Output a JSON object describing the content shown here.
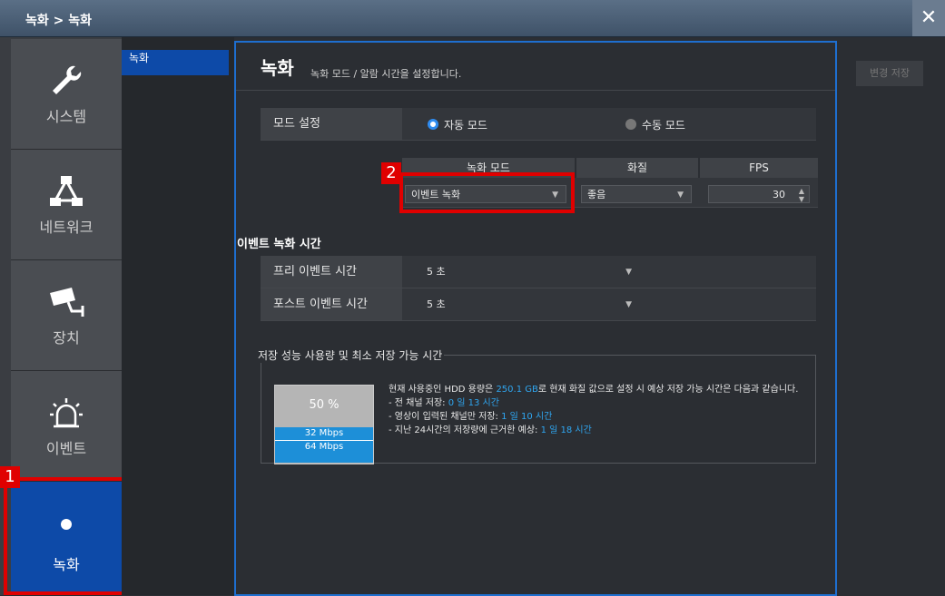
{
  "window": {
    "title": "녹화 > 녹화",
    "close": "✕"
  },
  "sidebar": {
    "items": [
      {
        "label": "시스템",
        "icon": "wrench-icon"
      },
      {
        "label": "네트워크",
        "icon": "network-icon"
      },
      {
        "label": "장치",
        "icon": "camera-icon"
      },
      {
        "label": "이벤트",
        "icon": "alarm-icon"
      },
      {
        "label": "녹화",
        "icon": "dot-icon",
        "active": true
      }
    ]
  },
  "subnav": {
    "items": [
      {
        "label": "녹화"
      }
    ]
  },
  "toolbar": {
    "save_label": "변경 저장"
  },
  "header": {
    "title": "녹화",
    "subtitle": "녹화 모드 / 알람 시간을 설정합니다."
  },
  "mode": {
    "label": "모드 설정",
    "auto": "자동 모드",
    "manual": "수동 모드",
    "selected": "auto"
  },
  "record_table": {
    "headers": [
      "녹화 모드",
      "화질",
      "FPS"
    ],
    "record_mode": "이벤트 녹화",
    "quality": "좋음",
    "fps": "30"
  },
  "event_time": {
    "section_title": "이벤트 녹화 시간",
    "pre_label": "프리 이벤트 시간",
    "pre_value": "5 초",
    "post_label": "포스트 이벤트 시간",
    "post_value": "5 초"
  },
  "storage": {
    "legend": "저장 성능 사용량 및 최소 저장 가능 시간",
    "percent": "50 %",
    "bar1": "32 Mbps",
    "bar2": "64 Mbps",
    "line1_a": "현재 사용중인 HDD 용량은 ",
    "line1_hdd": "250.1 GB",
    "line1_b": "로 현재 화질 값으로 설정 시 예상 저장 가능 시간은 다음과 같습니다.",
    "all_label": "- 전 채널 저장: ",
    "all_value": "0 일 13 시간",
    "motion_label": "- 영상이 입력된 채널만 저장: ",
    "motion_value": "1 일 10 시간",
    "past_label": "- 지난 24시간의 저장량에 근거한 예상: ",
    "past_value": "1 일 18 시간"
  },
  "badges": {
    "one": "1",
    "two": "2"
  },
  "colors": {
    "accent": "#0d4aa8",
    "highlight": "#2fa6f0",
    "annotation": "#e00000"
  }
}
